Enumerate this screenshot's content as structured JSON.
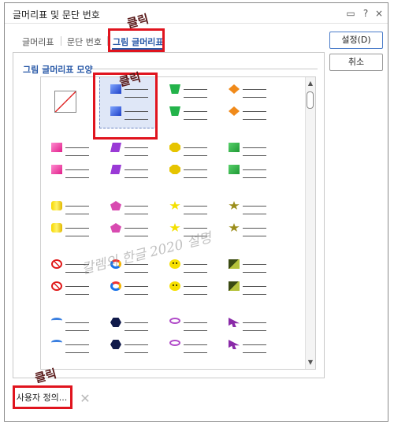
{
  "titlebar": {
    "title": "글머리표 및 문단 번호",
    "help": "?",
    "close": "×"
  },
  "tabs": [
    {
      "label": "글머리표"
    },
    {
      "label": "문단 번호"
    },
    {
      "label": "그림 글머리표"
    }
  ],
  "group_title": "그림 글머리표 모양",
  "side_buttons": {
    "ok": "설정(D)",
    "cancel": "취소"
  },
  "custom_button": "사용자 정의...",
  "annotation": "클릭",
  "watermark": "칼렘의 한글 2020 설명",
  "bullet_grid": [
    [
      "none",
      "blue-square",
      "green-trapezoid",
      "orange-diamond"
    ],
    [
      "pink-square",
      "purple-parallelogram",
      "yellow-octagon",
      "green-box"
    ],
    [
      "yellow-cylinder",
      "pink-pentagon",
      "yellow-star",
      "olive-star"
    ],
    [
      "red-prohibit",
      "rainbow-ring",
      "smiley",
      "pyramid"
    ],
    [
      "blue-arc",
      "navy-hexagon",
      "purple-oval",
      "purple-arrow"
    ]
  ],
  "colors": {
    "accent": "#2a5aa8",
    "highlight": "#e0141e"
  }
}
